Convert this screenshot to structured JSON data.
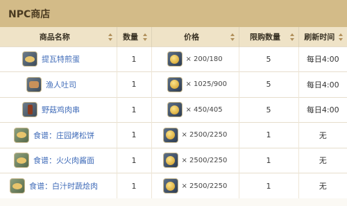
{
  "header": {
    "title": "NPC商店"
  },
  "columns": [
    "商品名称",
    "数量",
    "价格",
    "限购数量",
    "刷新时间"
  ],
  "rows": [
    {
      "icon": "egg-dish-icon",
      "name": "提瓦特煎蛋",
      "qty": "1",
      "price": "× 200/180",
      "limit": "5",
      "refresh": "每日4:00"
    },
    {
      "icon": "toast-icon",
      "name": "渔人吐司",
      "qty": "1",
      "price": "× 1025/900",
      "limit": "5",
      "refresh": "每日4:00"
    },
    {
      "icon": "skewer-icon",
      "name": "野菇鸡肉串",
      "qty": "1",
      "price": "× 450/405",
      "limit": "5",
      "refresh": "每日4:00"
    },
    {
      "icon": "recipe-icon",
      "name": "食谱：庄园烤松饼",
      "qty": "1",
      "price": "× 2500/2250",
      "limit": "1",
      "refresh": "无"
    },
    {
      "icon": "recipe-icon",
      "name": "食谱：火火肉酱面",
      "qty": "1",
      "price": "× 2500/2250",
      "limit": "1",
      "refresh": "无"
    },
    {
      "icon": "recipe-icon",
      "name": "食谱：白汁时蔬烩肉",
      "qty": "1",
      "price": "× 2500/2250",
      "limit": "1",
      "refresh": "无"
    }
  ]
}
